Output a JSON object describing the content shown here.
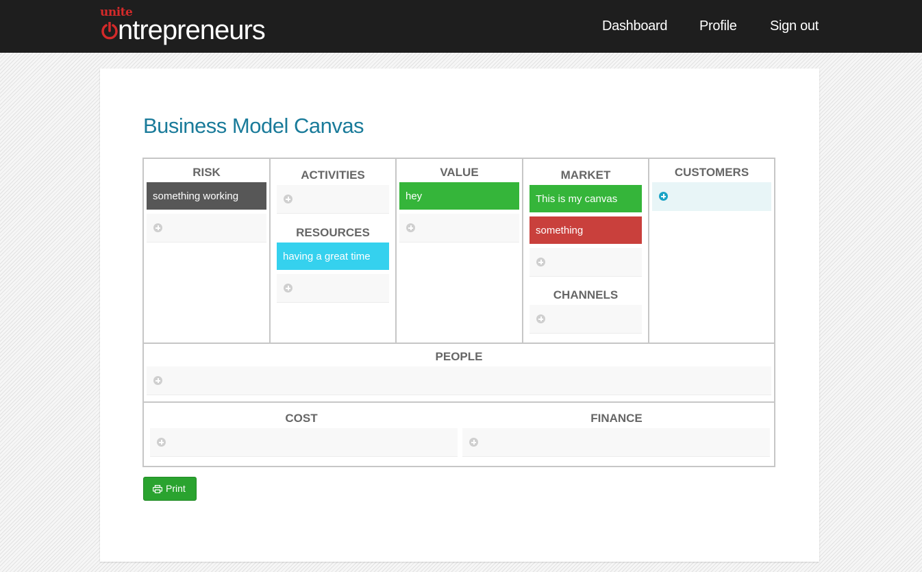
{
  "header": {
    "logo_small": "unite",
    "logo_main": "ntrepreneurs",
    "nav": [
      {
        "label": "Dashboard"
      },
      {
        "label": "Profile"
      },
      {
        "label": "Sign out"
      }
    ]
  },
  "page": {
    "title": "Business Model Canvas"
  },
  "canvas": {
    "risk": {
      "heading": "RISK",
      "notes": [
        {
          "text": "something working",
          "color": "#575757"
        }
      ]
    },
    "activities": {
      "heading": "ACTIVITIES",
      "notes": []
    },
    "resources": {
      "heading": "RESOURCES",
      "notes": [
        {
          "text": "having a great time",
          "color": "#35d1ee"
        }
      ]
    },
    "value": {
      "heading": "VALUE",
      "notes": [
        {
          "text": "hey",
          "color": "#35b53a"
        }
      ]
    },
    "market": {
      "heading": "MARKET",
      "notes": [
        {
          "text": "This is my canvas",
          "color": "#35b53a"
        },
        {
          "text": "something",
          "color": "#c9403c"
        }
      ]
    },
    "channels": {
      "heading": "CHANNELS",
      "notes": []
    },
    "customers": {
      "heading": "CUSTOMERS",
      "notes": []
    },
    "people": {
      "heading": "PEOPLE",
      "notes": []
    },
    "cost": {
      "heading": "COST",
      "notes": []
    },
    "finance": {
      "heading": "FINANCE",
      "notes": []
    }
  },
  "actions": {
    "print_label": "Print"
  },
  "colors": {
    "accent": "#1a7b9a",
    "brand_red": "#d42a2a",
    "print_green": "#2aa32f"
  }
}
